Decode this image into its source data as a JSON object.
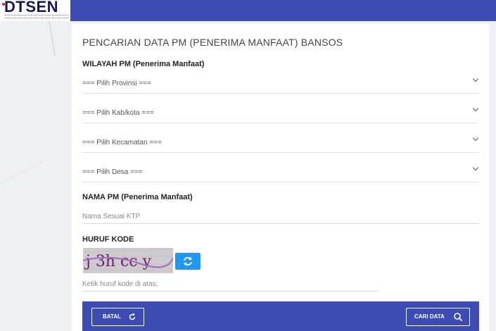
{
  "header": {
    "logo_text": "DTSEN"
  },
  "colors": {
    "primary": "#3d4bb3",
    "refresh_button": "#2196f3",
    "background": "#eef0f4"
  },
  "form": {
    "title": "PENCARIAN DATA PM (PENERIMA MANFAAT) BANSOS",
    "wilayah_label": "WILAYAH PM (Penerima Manfaat)",
    "provinsi": "=== Pilih Provinsi ===",
    "kabkota": "=== Pilih Kab/kota ===",
    "kecamatan": "=== Pilih Kecamatan ===",
    "desa": "=== Pilih Desa ===",
    "nama_label": "NAMA PM (Penerima Manfaat)",
    "nama_placeholder": "Nama Sesuai KTP",
    "kode_label": "HURUF KODE",
    "captcha_text": "j 3h cc y",
    "kode_placeholder": "Ketik huruf kode di atas:"
  },
  "buttons": {
    "batal": "BATAL",
    "cari": "CARI DATA"
  },
  "icons": {
    "refresh": "refresh-icon",
    "search": "search-icon"
  }
}
